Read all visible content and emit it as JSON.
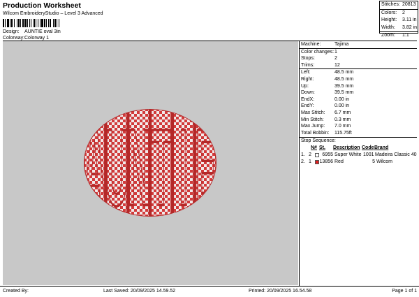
{
  "header": {
    "title": "Production Worksheet",
    "subtitle": "Wilcom EmbroideryStudio – Level 3 Advanced",
    "design_label": "Design:",
    "design_value": "AUNTIE oval 3in",
    "colorway_label": "Colorway:",
    "colorway_value": "Colorway 1"
  },
  "summary": [
    {
      "label": "Stitches:",
      "value": "20813"
    },
    {
      "label": "Colors:",
      "value": "2"
    },
    {
      "label": "Height:",
      "value": "3.11 in"
    },
    {
      "label": "Width:",
      "value": "3.82 in"
    },
    {
      "label": "Zoom:",
      "value": "1:1"
    }
  ],
  "design_preview": {
    "letters": [
      "A",
      "U",
      "N",
      "T",
      "I",
      "E"
    ],
    "fill_color": "#d23a3a",
    "background": "#c8c8c8"
  },
  "properties": [
    {
      "label": "Machine:",
      "value": "Tajima"
    },
    {
      "label": "Color changes:",
      "value": "1"
    },
    {
      "label": "Stops:",
      "value": "2"
    },
    {
      "label": "Trims:",
      "value": "12"
    },
    {
      "label": "Left:",
      "value": "48.5 mm"
    },
    {
      "label": "Right:",
      "value": "48.5 mm"
    },
    {
      "label": "Up:",
      "value": "39.5 mm"
    },
    {
      "label": "Down:",
      "value": "39.5 mm"
    },
    {
      "label": "EndX:",
      "value": "0.00 in"
    },
    {
      "label": "EndY:",
      "value": "0.00 in"
    },
    {
      "label": "Max Stitch:",
      "value": "6.7 mm"
    },
    {
      "label": "Min Stitch:",
      "value": "0.3 mm"
    },
    {
      "label": "Max Jump:",
      "value": "7.0 mm"
    },
    {
      "label": "Total Bobbin:",
      "value": "115.75ft"
    }
  ],
  "stop_sequence": {
    "title": "Stop Sequence:",
    "headers": {
      "n": "N#",
      "st": "St.",
      "desc": "Description",
      "code": "Code",
      "brand": "Brand"
    },
    "rows": [
      {
        "idx": "1.",
        "n": "2",
        "color": "#ffffff",
        "st": "6955",
        "desc": "Super White",
        "code": "1001",
        "brand": "Madeira Classic 40"
      },
      {
        "idx": "2.",
        "n": "1",
        "color": "#e02020",
        "st": "13856",
        "desc": "Red",
        "code": "5",
        "brand": "Wilcom"
      }
    ]
  },
  "footer": {
    "created_by": "Created By:",
    "last_saved": "Last Saved: 20/09/2025 14.59.52",
    "printed": "Printed: 20/09/2025 16.54.58",
    "page": "Page 1 of 1"
  }
}
